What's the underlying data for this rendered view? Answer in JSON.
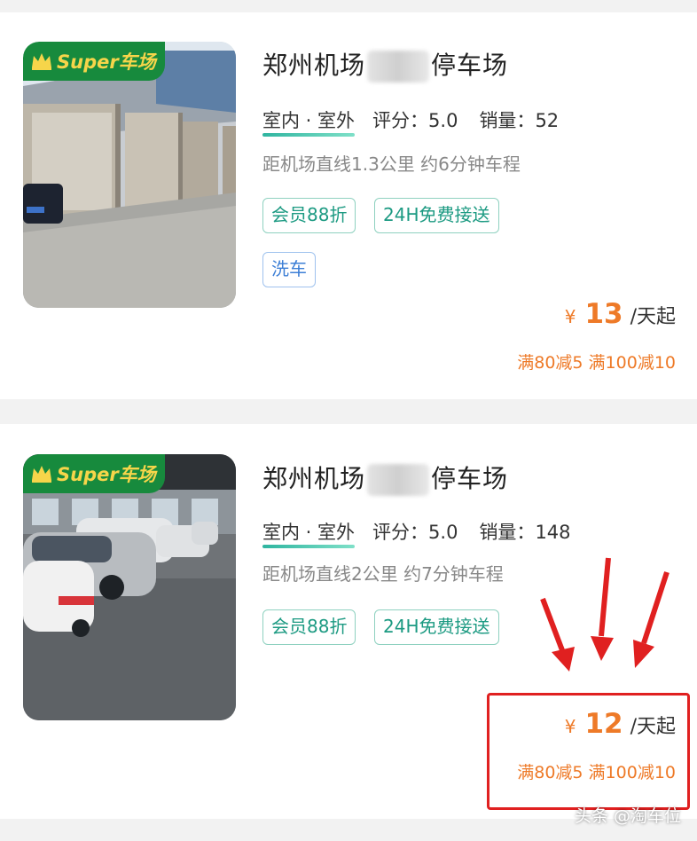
{
  "listings": [
    {
      "badge": {
        "icon": "crown-icon",
        "text": "Super车场"
      },
      "title_before": "郑州机场",
      "title_after": "停车场",
      "environment": "室内 · 室外",
      "rating_label": "评分：",
      "rating": "5.0",
      "sales_label": "销量：",
      "sales": "52",
      "distance": "距机场直线1.3公里 约6分钟车程",
      "tags": [
        "会员88折",
        "24H免费接送",
        "洗车"
      ],
      "price_symbol": "¥",
      "price": "13",
      "price_unit": "/天起",
      "promo": "满80减5 满100减10"
    },
    {
      "badge": {
        "icon": "crown-icon",
        "text": "Super车场"
      },
      "title_before": "郑州机场",
      "title_after": "停车场",
      "environment": "室内 · 室外",
      "rating_label": "评分：",
      "rating": "5.0",
      "sales_label": "销量：",
      "sales": "148",
      "distance": "距机场直线2公里 约7分钟车程",
      "tags": [
        "会员88折",
        "24H免费接送"
      ],
      "price_symbol": "¥",
      "price": "12",
      "price_unit": "/天起",
      "promo": "满80减5 满100减10"
    }
  ],
  "annotation": {
    "arrow_color": "#e02020",
    "box_color": "#e02020"
  },
  "watermark": "头条 @淘车位",
  "colors": {
    "accent_orange": "#ee7a28",
    "tag_green": "#1c9a82",
    "tag_blue": "#3d7fd6",
    "badge_green": "#178a3d"
  }
}
